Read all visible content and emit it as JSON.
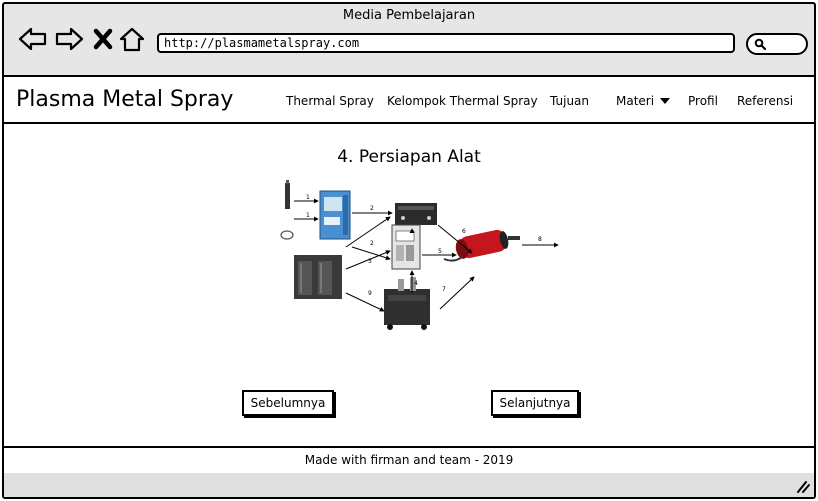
{
  "browser": {
    "title": "Media Pembelajaran",
    "url": "http://plasmametalspray.com"
  },
  "header": {
    "brand": "Plasma Metal Spray",
    "nav": [
      "Thermal Spray",
      "Kelompok Thermal Spray",
      "Tujuan",
      "Materi",
      "Profil",
      "Referensi"
    ]
  },
  "main": {
    "heading": "4. Persiapan Alat",
    "prev_label": "Sebelumnya",
    "next_label": "Selanjutnya"
  },
  "diagram": {
    "arrow_labels": [
      "1",
      "1",
      "2",
      "2",
      "3",
      "4",
      "5",
      "6",
      "7",
      "8",
      "9"
    ]
  },
  "footer": {
    "text": "Made with firman and team - 2019"
  }
}
